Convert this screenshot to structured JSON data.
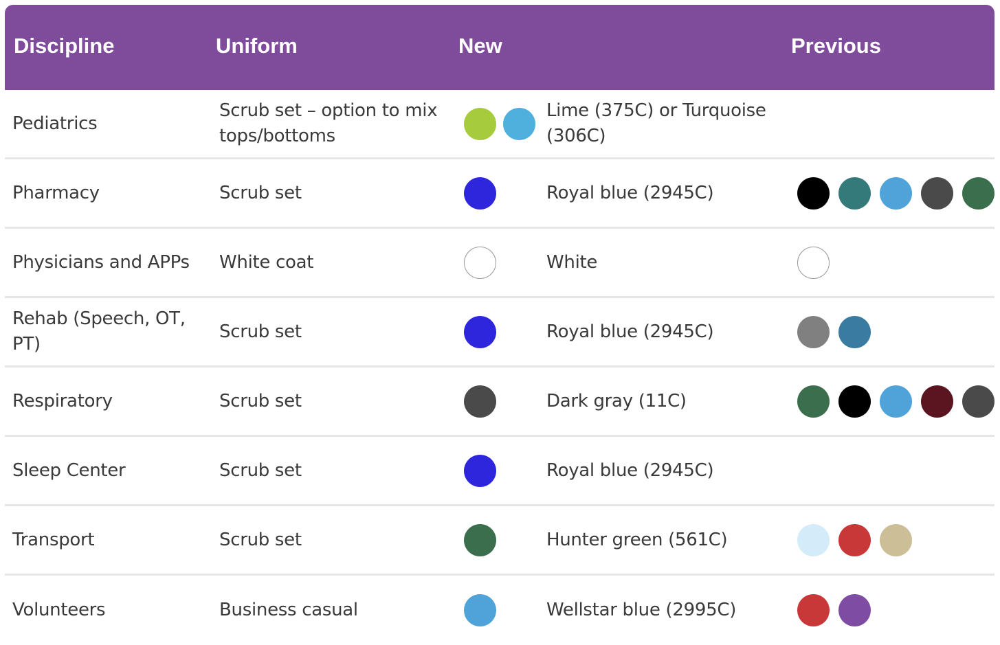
{
  "header": {
    "discipline": "Discipline",
    "uniform": "Uniform",
    "new": "New",
    "previous": "Previous"
  },
  "rows": [
    {
      "discipline": "Pediatrics",
      "uniform": "Scrub set – option to mix tops/bottoms",
      "new_colors": [
        "#a6cb3c",
        "#4fb0dd"
      ],
      "new_name": "Lime (375C) or Turquoise (306C)",
      "previous_colors": []
    },
    {
      "discipline": "Pharmacy",
      "uniform": "Scrub set",
      "new_colors": [
        "#2e26dd"
      ],
      "new_name": "Royal blue (2945C)",
      "previous_colors": [
        "#000000",
        "#357a7a",
        "#4fa3d9",
        "#4a4a4a",
        "#3b6e4c"
      ]
    },
    {
      "discipline": "Physicians and APPs",
      "uniform": "White coat",
      "new_colors": [
        "#ffffff"
      ],
      "new_name": "White",
      "previous_colors": [
        "#ffffff"
      ]
    },
    {
      "discipline": "Rehab (Speech, OT, PT)",
      "uniform": "Scrub set",
      "new_colors": [
        "#2e26dd"
      ],
      "new_name": "Royal blue (2945C)",
      "previous_colors": [
        "#808080",
        "#3a7ba1"
      ]
    },
    {
      "discipline": "Respiratory",
      "uniform": "Scrub set",
      "new_colors": [
        "#4a4a4a"
      ],
      "new_name": "Dark gray (11C)",
      "previous_colors": [
        "#3b6e4c",
        "#000000",
        "#4fa3d9",
        "#5a1520",
        "#4a4a4a"
      ]
    },
    {
      "discipline": "Sleep Center",
      "uniform": "Scrub set",
      "new_colors": [
        "#2e26dd"
      ],
      "new_name": "Royal blue (2945C)",
      "previous_colors": []
    },
    {
      "discipline": "Transport",
      "uniform": "Scrub set",
      "new_colors": [
        "#3b6e4c"
      ],
      "new_name": "Hunter green (561C)",
      "previous_colors": [
        "#d4ecf9",
        "#c93838",
        "#ccbf98"
      ]
    },
    {
      "discipline": "Volunteers",
      "uniform": "Business casual",
      "new_colors": [
        "#4fa3d9"
      ],
      "new_name": "Wellstar blue (2995C)",
      "previous_colors": [
        "#c93838",
        "#7f4ca3"
      ]
    }
  ]
}
